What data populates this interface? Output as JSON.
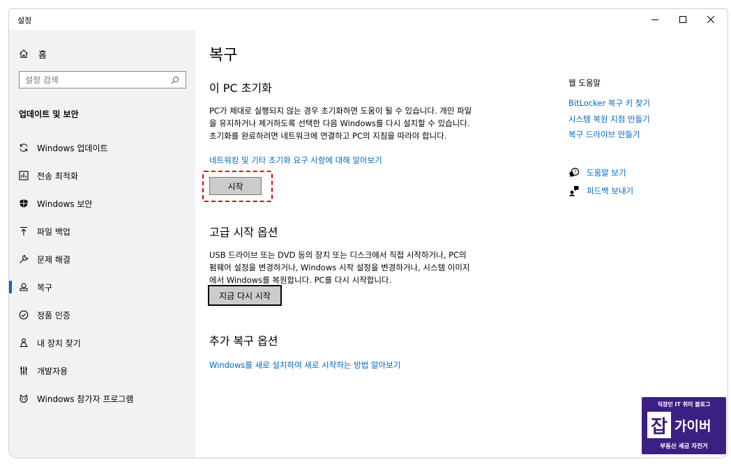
{
  "window": {
    "title": "설정",
    "controls": [
      "minimize-icon",
      "maximize-icon",
      "close-icon"
    ]
  },
  "sidebar": {
    "home_label": "홈",
    "search_placeholder": "설정 검색",
    "section_title": "업데이트 및 보안",
    "items": [
      {
        "label": "Windows 업데이트",
        "icon": "sync-icon"
      },
      {
        "label": "전송 최적화",
        "icon": "delivery-optimization-icon"
      },
      {
        "label": "Windows 보안",
        "icon": "shield-icon"
      },
      {
        "label": "파일 백업",
        "icon": "backup-arrow-icon"
      },
      {
        "label": "문제 해결",
        "icon": "wrench-icon"
      },
      {
        "label": "복구",
        "icon": "recovery-icon",
        "active": true
      },
      {
        "label": "정품 인증",
        "icon": "check-circle-icon"
      },
      {
        "label": "내 장치 찾기",
        "icon": "person-location-icon"
      },
      {
        "label": "개발자용",
        "icon": "developer-icon"
      },
      {
        "label": "Windows 참가자 프로그램",
        "icon": "insider-icon"
      }
    ]
  },
  "main": {
    "title": "복구",
    "reset": {
      "heading": "이 PC 초기화",
      "description": "PC가 제대로 실행되지 않는 경우 초기화하면 도움이 될 수 있습니다. 개인 파일을 유지하거나 제거하도록 선택한 다음 Windows를 다시 설치할 수 있습니다. 초기화를 완료하려면 네트워크에 연결하고 PC의 지침을 따라야 합니다.",
      "link": "네트워킹 및 기타 초기화 요구 사항에 대해 알아보기",
      "button": "시작"
    },
    "advanced": {
      "heading": "고급 시작 옵션",
      "description": "USB 드라이브 또는 DVD 등의 장치 또는 디스크에서 직접 시작하거나, PC의 펌웨어 설정을 변경하거나, Windows 시작 설정을 변경하거나, 시스템 이미지에서 Windows를 복원합니다. PC를 다시 시작합니다.",
      "button": "지금 다시 시작"
    },
    "more": {
      "heading": "추가 복구 옵션",
      "link": "Windows를 새로 설치하여 새로 시작하는 방법 알아보기"
    }
  },
  "help": {
    "title": "웹 도움말",
    "links": [
      "BitLocker 복구 키 찾기",
      "시스템 복원 지점 만들기",
      "복구 드라이브 만들기"
    ],
    "get_help": "도움말 보기",
    "feedback": "피드백 보내기"
  },
  "watermark": {
    "top": "직장인 IT 취미 블로그",
    "big": "잡",
    "name": "가이버",
    "bottom": "부동산 세금 자전거"
  },
  "colors": {
    "accent": "#0067c0",
    "sidebar_bg": "#f2f2f2",
    "highlight": "#e00000",
    "watermark_bg": "#3b1f82"
  }
}
